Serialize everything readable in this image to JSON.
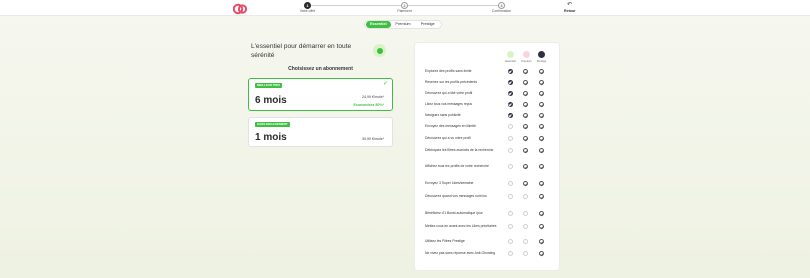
{
  "header": {
    "steps": [
      {
        "number": "1",
        "label": "Votre offre",
        "state": "active"
      },
      {
        "number": "2",
        "label": "Paiement",
        "state": "idle"
      },
      {
        "number": "3",
        "label": "Confirmation",
        "state": "idle"
      }
    ],
    "back_label": "Retour",
    "back_icon": "arrow-left-icon"
  },
  "tabs": [
    {
      "label": "Essentiel",
      "active": true
    },
    {
      "label": "Premium",
      "active": false
    },
    {
      "label": "Prestige",
      "active": false
    }
  ],
  "headline": "L'essentiel pour démarrer en toute sérénité",
  "choose_title": "Choisissez un abonnement",
  "plans": [
    {
      "badge": "MEILLEUR PRIX",
      "duration": "6 mois",
      "price": "24,99 €/mois*",
      "savings": "Economisez 50%*",
      "selected": true
    },
    {
      "badge": "SANS ENGAGEMENT",
      "duration": "1 mois",
      "price": "39,99 €/mois*",
      "savings": "",
      "selected": false
    }
  ],
  "tiers": [
    {
      "label": "Essentiel",
      "color": "#3fbf3f"
    },
    {
      "label": "Premium",
      "color": "#e94b6a"
    },
    {
      "label": "Prestige",
      "color": "#2f3142"
    }
  ],
  "features": [
    {
      "text": "Explorez des profils sans limite",
      "marks": [
        "filled",
        "outline",
        "outline"
      ]
    },
    {
      "text": "Revenez sur les profils précédents",
      "marks": [
        "filled",
        "outline",
        "outline"
      ]
    },
    {
      "text": "Découvrez qui a liké votre profil",
      "marks": [
        "filled",
        "outline",
        "outline"
      ]
    },
    {
      "text": "Likez tous vos messages reçus",
      "marks": [
        "filled",
        "outline",
        "outline"
      ]
    },
    {
      "text": "Naviguez sans publicité",
      "marks": [
        "filled",
        "outline",
        "outline"
      ]
    },
    {
      "text": "Envoyez des messages en illimité",
      "marks": [
        "empty",
        "outline",
        "outline"
      ]
    },
    {
      "text": "Découvrez qui a vu votre profil",
      "marks": [
        "empty",
        "outline",
        "outline"
      ]
    },
    {
      "text": "Débloquez les filtres avancés de la recherche",
      "marks": [
        "empty",
        "outline",
        "outline"
      ]
    },
    {
      "text": "Affichez tous les profils de votre recherche",
      "marks": [
        "empty",
        "outline",
        "outline"
      ]
    },
    {
      "text": "Envoyez 3 Super Likes/semaine",
      "marks": [
        "empty",
        "outline",
        "outline"
      ]
    },
    {
      "text": "Découvrez quand vos messages sont lus",
      "marks": [
        "empty",
        "empty",
        "outline"
      ]
    },
    {
      "text": "Bénéficiez d'1 Boost automatique /jour",
      "marks": [
        "empty",
        "empty",
        "outline"
      ]
    },
    {
      "text": "Mettez-vous en avant avec les Likes prioritaires",
      "marks": [
        "empty",
        "empty",
        "outline"
      ]
    },
    {
      "text": "Utilisez les Filtres Prestige",
      "marks": [
        "empty",
        "empty",
        "outline"
      ]
    },
    {
      "text": "Ne vivez pas sans réponse avec Anti-Ghosting",
      "marks": [
        "empty",
        "empty",
        "outline"
      ]
    }
  ]
}
